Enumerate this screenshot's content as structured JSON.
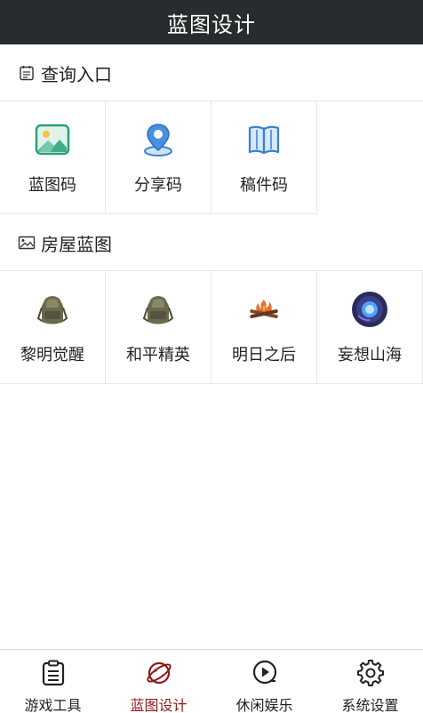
{
  "header": {
    "title": "蓝图设计"
  },
  "section1": {
    "title": "查询入口",
    "items": [
      {
        "label": "蓝图码",
        "icon": "image-icon"
      },
      {
        "label": "分享码",
        "icon": "location-pin-icon"
      },
      {
        "label": "稿件码",
        "icon": "book-icon"
      }
    ]
  },
  "section2": {
    "title": "房屋蓝图",
    "items": [
      {
        "label": "黎明觉醒",
        "icon": "backpack-icon"
      },
      {
        "label": "和平精英",
        "icon": "backpack-icon"
      },
      {
        "label": "明日之后",
        "icon": "campfire-icon"
      },
      {
        "label": "妄想山海",
        "icon": "blue-orb-icon"
      }
    ]
  },
  "tabbar": {
    "active_color": "#8b1a1a",
    "tabs": [
      {
        "label": "游戏工具",
        "icon": "clipboard-list-icon"
      },
      {
        "label": "蓝图设计",
        "icon": "planet-icon",
        "active": true
      },
      {
        "label": "休闲娱乐",
        "icon": "play-circle-icon"
      },
      {
        "label": "系统设置",
        "icon": "gear-icon"
      }
    ]
  }
}
